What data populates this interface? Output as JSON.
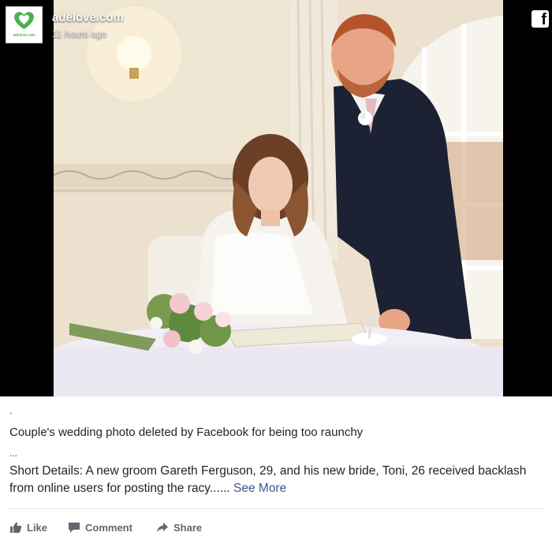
{
  "page": {
    "name": "adelove.com",
    "time": "11 hours ago",
    "logo_text": "adelove.com",
    "brand_color": "#4caf50"
  },
  "post": {
    "dot": ".",
    "headline": "Couple's wedding photo deleted by Facebook for being too raunchy",
    "ellipsis": "...",
    "details": "Short Details: A new groom Gareth Ferguson, 29, and his new bride, Toni, 26 received backlash from online users for posting the racy......",
    "see_more": "See More"
  },
  "actions": {
    "like": "Like",
    "comment": "Comment",
    "share": "Share"
  },
  "icons": {
    "facebook": "facebook-f-icon",
    "like": "thumbs-up-icon",
    "comment": "speech-bubble-icon",
    "share": "share-arrow-icon"
  },
  "fb_glyph": "f",
  "colors": {
    "link": "#385898",
    "action_text": "#606770",
    "text": "#1d2129"
  }
}
